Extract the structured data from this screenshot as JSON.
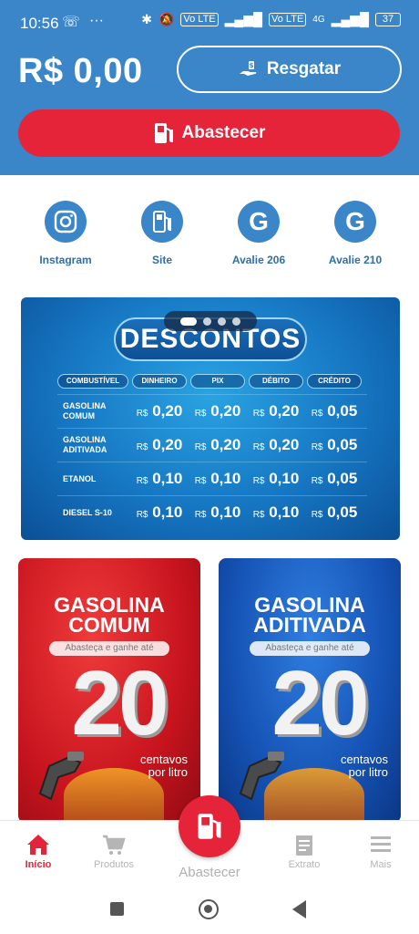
{
  "status_bar": {
    "time": "10:56",
    "left_icons": [
      "missed-call-icon",
      "more-dots-icon"
    ],
    "signal_badges": [
      "Vo LTE",
      "Vo LTE",
      "4G"
    ],
    "battery": "37"
  },
  "header": {
    "balance": "R$ 0,00",
    "resgatar_label": "Resgatar",
    "abastecer_label": "Abastecer",
    "colors": {
      "header_bg": "#3a86c8",
      "accent": "#e5243a"
    }
  },
  "quick_links": [
    {
      "label": "Instagram",
      "icon": "instagram-icon",
      "glyph": "◎"
    },
    {
      "label": "Site",
      "icon": "fuel-pump-icon",
      "glyph": "⛽"
    },
    {
      "label": "Avalie 206",
      "icon": "google-icon",
      "glyph": "G"
    },
    {
      "label": "Avalie 210",
      "icon": "google-icon",
      "glyph": "G"
    }
  ],
  "descontos": {
    "title": "DESCONTOS",
    "columns": [
      "COMBUSTÍVEL",
      "DINHEIRO",
      "PIX",
      "DÉBITO",
      "CRÉDITO"
    ],
    "currency": "R$",
    "rows": [
      {
        "fuel": "GASOLINA COMUM",
        "prices": [
          "0,20",
          "0,20",
          "0,20",
          "0,05"
        ]
      },
      {
        "fuel": "GASOLINA ADITIVADA",
        "prices": [
          "0,20",
          "0,20",
          "0,20",
          "0,05"
        ]
      },
      {
        "fuel": "ETANOL",
        "prices": [
          "0,10",
          "0,10",
          "0,10",
          "0,05"
        ]
      },
      {
        "fuel": "DIESEL S-10",
        "prices": [
          "0,10",
          "0,10",
          "0,10",
          "0,05"
        ]
      }
    ],
    "carousel_dots": 4,
    "active_dot": 0
  },
  "promo_cards": [
    {
      "title_line1": "GASOLINA",
      "title_line2": "COMUM",
      "pill": "Abasteça e ganhe até",
      "number": "20",
      "unit_line1": "centavos",
      "unit_line2": "por litro",
      "color": "red"
    },
    {
      "title_line1": "GASOLINA",
      "title_line2": "ADITIVADA",
      "pill": "Abasteça e ganhe até",
      "number": "20",
      "unit_line1": "centavos",
      "unit_line2": "por litro",
      "color": "blue"
    }
  ],
  "bottom_nav": {
    "items": [
      {
        "label": "Início",
        "icon": "home-icon",
        "active": true
      },
      {
        "label": "Produtos",
        "icon": "cart-icon",
        "active": false
      },
      {
        "label": "Extrato",
        "icon": "receipt-icon",
        "active": false
      },
      {
        "label": "Mais",
        "icon": "menu-icon",
        "active": false
      }
    ],
    "fab_label": "Abastecer"
  },
  "system_nav": [
    "recents-icon",
    "home-circle-icon",
    "back-icon"
  ]
}
